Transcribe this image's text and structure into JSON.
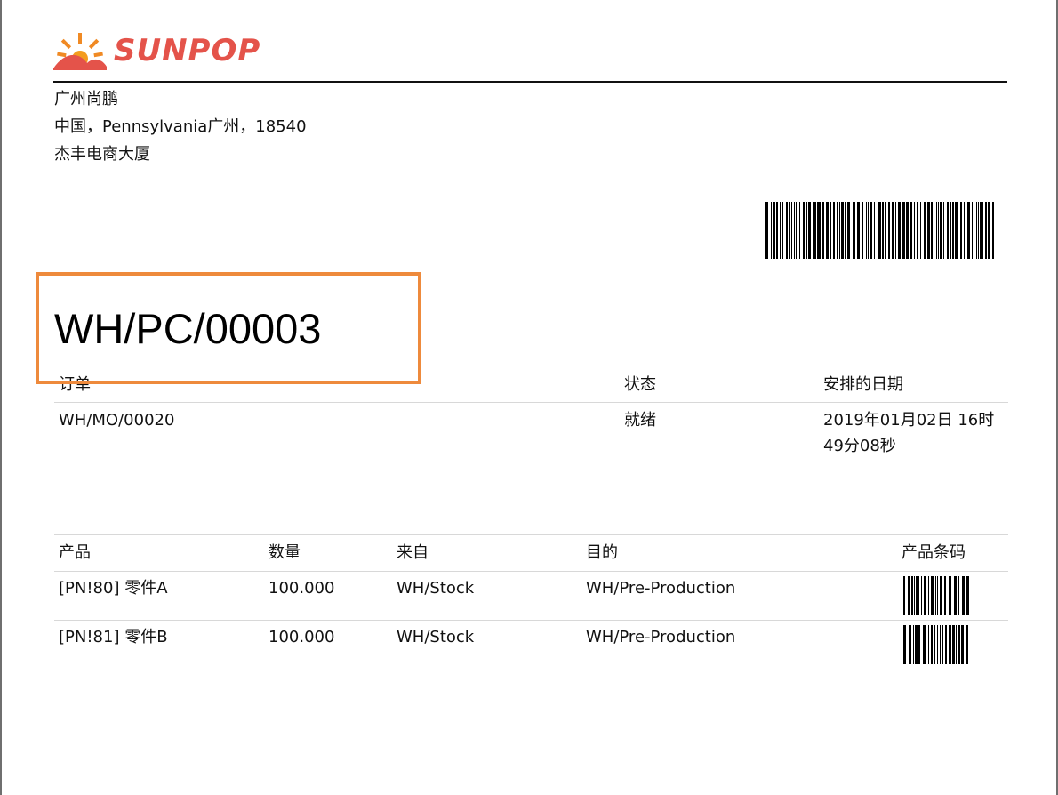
{
  "company": {
    "logo_text": "SUNPOP",
    "name": "广州尚鹏",
    "address_line1": "中国，Pennsylvania广州，18540",
    "address_line2": "杰丰电商大厦"
  },
  "document": {
    "reference": "WH/PC/00003"
  },
  "order_table": {
    "headers": {
      "order": "订单",
      "status": "状态",
      "scheduled": "安排的日期"
    },
    "row": {
      "order": "WH/MO/00020",
      "status": "就绪",
      "scheduled_line1": "2019年01月02日 16时",
      "scheduled_line2": "49分08秒"
    }
  },
  "products_table": {
    "headers": {
      "product": "产品",
      "quantity": "数量",
      "from": "来自",
      "to": "目的",
      "barcode": "产品条码"
    },
    "rows": [
      {
        "product": "[PN!80] 零件A",
        "quantity": "100.000",
        "from": "WH/Stock",
        "to": "WH/Pre-Production"
      },
      {
        "product": "[PN!81] 零件B",
        "quantity": "100.000",
        "from": "WH/Stock",
        "to": "WH/Pre-Production"
      }
    ]
  },
  "colors": {
    "brand": "#e4534a",
    "highlight": "#ee8a3c"
  }
}
